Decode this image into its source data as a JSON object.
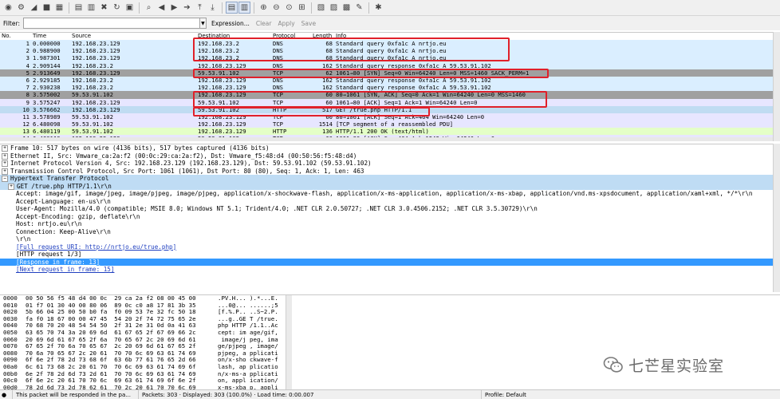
{
  "toolbar": {
    "buttons": [
      {
        "name": "interface-list-icon",
        "glyph": "◉"
      },
      {
        "name": "capture-options-icon",
        "glyph": "⚙"
      },
      {
        "name": "start-capture-icon",
        "glyph": "◢"
      },
      {
        "name": "stop-capture-icon",
        "glyph": "■"
      },
      {
        "name": "restart-capture-icon",
        "glyph": "▦"
      },
      {
        "sep": true
      },
      {
        "name": "open-file-icon",
        "glyph": "▤"
      },
      {
        "name": "save-file-icon",
        "glyph": "▥"
      },
      {
        "name": "close-file-icon",
        "glyph": "✖"
      },
      {
        "name": "reload-icon",
        "glyph": "↻"
      },
      {
        "name": "print-icon",
        "glyph": "▣"
      },
      {
        "sep": true
      },
      {
        "name": "find-packet-icon",
        "glyph": "⌕"
      },
      {
        "name": "go-back-icon",
        "glyph": "◀"
      },
      {
        "name": "go-forward-icon",
        "glyph": "▶"
      },
      {
        "name": "go-to-packet-icon",
        "glyph": "➔"
      },
      {
        "name": "go-first-packet-icon",
        "glyph": "⤒"
      },
      {
        "name": "go-last-packet-icon",
        "glyph": "⤓"
      },
      {
        "sep": true
      },
      {
        "name": "colorize-icon",
        "glyph": "▤",
        "on": true
      },
      {
        "name": "auto-scroll-icon",
        "glyph": "▥",
        "on": true
      },
      {
        "sep": true
      },
      {
        "name": "zoom-in-icon",
        "glyph": "⊕"
      },
      {
        "name": "zoom-out-icon",
        "glyph": "⊖"
      },
      {
        "name": "zoom-normal-icon",
        "glyph": "⊙"
      },
      {
        "name": "resize-columns-icon",
        "glyph": "⊞"
      },
      {
        "sep": true
      },
      {
        "name": "capture-filters-icon",
        "glyph": "▧"
      },
      {
        "name": "display-filters-icon",
        "glyph": "▨"
      },
      {
        "name": "coloring-rules-icon",
        "glyph": "▩"
      },
      {
        "name": "preferences-icon",
        "glyph": "✎"
      },
      {
        "sep": true
      },
      {
        "name": "help-icon",
        "glyph": "✱"
      }
    ]
  },
  "filter": {
    "label": "Filter:",
    "value": "",
    "expression_label": "Expression...",
    "clear_label": "Clear",
    "apply_label": "Apply",
    "save_label": "Save"
  },
  "packet_list": {
    "columns": [
      "No.",
      "Time",
      "Source",
      "Destination",
      "Protocol",
      "Length",
      "Info"
    ],
    "rows": [
      {
        "no": "1",
        "time": "0.000000",
        "src": "192.168.23.129",
        "dst": "192.168.23.2",
        "proto": "DNS",
        "len": "68",
        "info": "Standard query 0xfa1c  A nrtjo.eu",
        "style": "dns"
      },
      {
        "no": "2",
        "time": "0.988900",
        "src": "192.168.23.129",
        "dst": "192.168.23.2",
        "proto": "DNS",
        "len": "68",
        "info": "Standard query 0xfa1c  A nrtjo.eu",
        "style": "dns"
      },
      {
        "no": "3",
        "time": "1.987301",
        "src": "192.168.23.129",
        "dst": "192.168.23.2",
        "proto": "DNS",
        "len": "68",
        "info": "Standard query 0xfa1c  A nrtjo.eu",
        "style": "dns"
      },
      {
        "no": "4",
        "time": "2.909144",
        "src": "192.168.23.2",
        "dst": "192.168.23.129",
        "proto": "DNS",
        "len": "162",
        "info": "Standard query response 0xfa1c  A 59.53.91.102",
        "style": "dns"
      },
      {
        "no": "5",
        "time": "2.913649",
        "src": "192.168.23.129",
        "dst": "59.53.91.102",
        "proto": "TCP",
        "len": "62",
        "info": "1061→80 [SYN] Seq=0 Win=64240 Len=0 MSS=1460 SACK_PERM=1",
        "style": "syn"
      },
      {
        "no": "6",
        "time": "2.929185",
        "src": "192.168.23.2",
        "dst": "192.168.23.129",
        "proto": "DNS",
        "len": "162",
        "info": "Standard query response 0xfa1c  A 59.53.91.102",
        "style": "dns"
      },
      {
        "no": "7",
        "time": "2.930238",
        "src": "192.168.23.2",
        "dst": "192.168.23.129",
        "proto": "DNS",
        "len": "162",
        "info": "Standard query response 0xfa1c  A 59.53.91.102",
        "style": "dns"
      },
      {
        "no": "8",
        "time": "3.575002",
        "src": "59.53.91.102",
        "dst": "192.168.23.129",
        "proto": "TCP",
        "len": "60",
        "info": "80→1061 [SYN, ACK] Seq=0 Ack=1 Win=64240 Len=0 MSS=1460",
        "style": "syn"
      },
      {
        "no": "9",
        "time": "3.575247",
        "src": "192.168.23.129",
        "dst": "59.53.91.102",
        "proto": "TCP",
        "len": "60",
        "info": "1061→80 [ACK] Seq=1 Ack=1 Win=64240 Len=0",
        "style": "tcp"
      },
      {
        "no": "10",
        "time": "3.576662",
        "src": "192.168.23.129",
        "dst": "59.53.91.102",
        "proto": "HTTP",
        "len": "517",
        "info": "GET /true.php HTTP/1.1",
        "style": "sel"
      },
      {
        "no": "11",
        "time": "3.578989",
        "src": "59.53.91.102",
        "dst": "192.168.23.129",
        "proto": "TCP",
        "len": "60",
        "info": "80→1061 [ACK] Seq=1 Ack=464 Win=64240 Len=0",
        "style": "tcp"
      },
      {
        "no": "12",
        "time": "6.480098",
        "src": "59.53.91.102",
        "dst": "192.168.23.129",
        "proto": "TCP",
        "len": "1514",
        "info": "[TCP segment of a reassembled PDU]",
        "style": "tcp"
      },
      {
        "no": "13",
        "time": "6.480119",
        "src": "59.53.91.102",
        "dst": "192.168.23.129",
        "proto": "HTTP",
        "len": "136",
        "info": "HTTP/1.1 200 OK  (text/html)",
        "style": "http"
      },
      {
        "no": "14",
        "time": "6.480119",
        "src": "192.168.23.129",
        "dst": "59.53.91.102",
        "proto": "TCP",
        "len": "60",
        "info": "1061→80 [ACK] Seq=464 Ack=1543 Win=64240 Len=0",
        "style": "tcp"
      }
    ]
  },
  "details": {
    "rows": [
      {
        "text": "Frame 10: 517 bytes on wire (4136 bits), 517 bytes captured (4136 bits)",
        "exp": "+",
        "indent": 0
      },
      {
        "text": "Ethernet II, Src: Vmware_ca:2a:f2 (00:0c:29:ca:2a:f2), Dst: Vmware_f5:48:d4 (00:50:56:f5:48:d4)",
        "exp": "+",
        "indent": 0
      },
      {
        "text": "Internet Protocol Version 4, Src: 192.168.23.129 (192.168.23.129), Dst: 59.53.91.102 (59.53.91.102)",
        "exp": "+",
        "indent": 0
      },
      {
        "text": "Transmission Control Protocol, Src Port: 1061 (1061), Dst Port: 80 (80), Seq: 1, Ack: 1, Len: 463",
        "exp": "+",
        "indent": 0
      },
      {
        "text": "Hypertext Transfer Protocol",
        "exp": "−",
        "indent": 0,
        "style": "hl"
      },
      {
        "text": "GET /true.php HTTP/1.1\\r\\n",
        "exp": "+",
        "indent": 1,
        "style": "hl"
      },
      {
        "text": "Accept: image/gif, image/jpeg, image/pjpeg, image/pjpeg, application/x-shockwave-flash, application/x-ms-application, application/x-ms-xbap, application/vnd.ms-xpsdocument, application/xaml+xml, */*\\r\\n",
        "indent": 2
      },
      {
        "text": "Accept-Language: en-us\\r\\n",
        "indent": 2
      },
      {
        "text": "User-Agent: Mozilla/4.0 (compatible; MSIE 8.0; Windows NT 5.1; Trident/4.0; .NET CLR 2.0.50727; .NET CLR 3.0.4506.2152; .NET CLR 3.5.30729)\\r\\n",
        "indent": 2
      },
      {
        "text": "Accept-Encoding: gzip, deflate\\r\\n",
        "indent": 2
      },
      {
        "text": "Host: nrtjo.eu\\r\\n",
        "indent": 2
      },
      {
        "text": "Connection: Keep-Alive\\r\\n",
        "indent": 2
      },
      {
        "text": "\\r\\n",
        "indent": 2
      },
      {
        "text": "[Full request URI: http://nrtjo.eu/true.php]",
        "indent": 2,
        "link": true
      },
      {
        "text": "[HTTP request 1/3]",
        "indent": 2
      },
      {
        "text": "[Response in frame: 13]",
        "indent": 2,
        "link": true,
        "style": "sel"
      },
      {
        "text": "[Next request in frame: 15]",
        "indent": 2,
        "link": true
      }
    ]
  },
  "bytes": {
    "rows": [
      {
        "off": "0000",
        "hex": "00 50 56 f5 48 d4 00 0c  29 ca 2a f2 08 00 45 00",
        "ascii": ".PV.H... ).*...E."
      },
      {
        "off": "0010",
        "hex": "01 f7 01 30 40 00 80 06  89 0c c0 a8 17 81 3b 35",
        "ascii": "...0@... ......;5"
      },
      {
        "off": "0020",
        "hex": "5b 66 04 25 00 50 b0 fa  f0 09 53 7e 32 fc 50 18",
        "ascii": "[f.%.P.. ..S~2.P."
      },
      {
        "off": "0030",
        "hex": "fa f0 18 67 00 00 47 45  54 20 2f 74 72 75 65 2e",
        "ascii": "...g..GE T /true."
      },
      {
        "off": "0040",
        "hex": "70 68 70 20 48 54 54 50  2f 31 2e 31 0d 0a 41 63",
        "ascii": "php HTTP /1.1..Ac"
      },
      {
        "off": "0050",
        "hex": "63 65 70 74 3a 20 69 6d  61 67 65 2f 67 69 66 2c",
        "ascii": "cept: im age/gif,"
      },
      {
        "off": "0060",
        "hex": "20 69 6d 61 67 65 2f 6a  70 65 67 2c 20 69 6d 61",
        "ascii": " image/j peg, ima"
      },
      {
        "off": "0070",
        "hex": "67 65 2f 70 6a 70 65 67  2c 20 69 6d 61 67 65 2f",
        "ascii": "ge/pjpeg , image/"
      },
      {
        "off": "0080",
        "hex": "70 6a 70 65 67 2c 20 61  70 70 6c 69 63 61 74 69",
        "ascii": "pjpeg, a pplicati"
      },
      {
        "off": "0090",
        "hex": "6f 6e 2f 78 2d 73 68 6f  63 6b 77 61 76 65 2d 66",
        "ascii": "on/x-sho ckwave-f"
      },
      {
        "off": "00a0",
        "hex": "6c 61 73 68 2c 20 61 70  70 6c 69 63 61 74 69 6f",
        "ascii": "lash, ap plicatio"
      },
      {
        "off": "00b0",
        "hex": "6e 2f 78 2d 6d 73 2d 61  70 70 6c 69 63 61 74 69",
        "ascii": "n/x-ms-a pplicati"
      },
      {
        "off": "00c0",
        "hex": "6f 6e 2c 20 61 70 70 6c  69 63 61 74 69 6f 6e 2f",
        "ascii": "on, appl ication/"
      },
      {
        "off": "00d0",
        "hex": "78 2d 6d 73 2d 78 62 61  70 2c 20 61 70 70 6c 69",
        "ascii": "x-ms-xba p, appli"
      },
      {
        "off": "00e0",
        "hex": "63 61 74 69 6f 6e 2f 76  6e 64 2e 6d 73 2d 78 70",
        "ascii": "cation/v nd.ms-xp"
      }
    ]
  },
  "watermark": {
    "text": "七芒星实验室"
  },
  "status": {
    "message": "This packet will be responded in the pa...",
    "packets": "Packets: 303 · Displayed: 303 (100.0%) · Load time: 0:00.007",
    "profile": "Profile: Default"
  },
  "colors": {
    "dns_row": "#daeeff",
    "tcp_row": "#e7e6ff",
    "syn_row": "#a0a0a0",
    "http_row": "#e4ffc7",
    "selected_row": "#c0dcf2",
    "detail_selected": "#3399ff",
    "annotation_red": "#e0202a"
  }
}
